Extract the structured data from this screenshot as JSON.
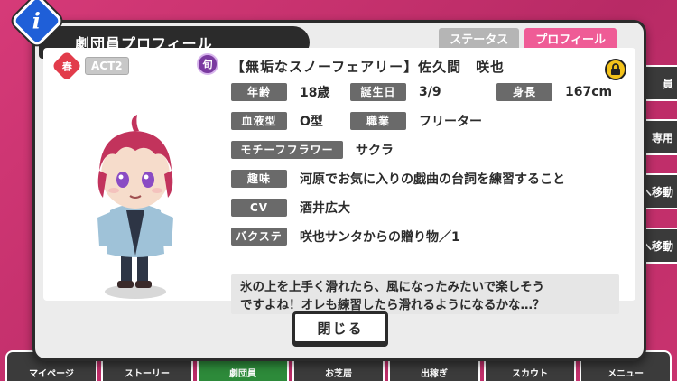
{
  "header": {
    "title": "劇団員プロフィール",
    "info_icon": "i"
  },
  "tabs": [
    {
      "label": "ステータス"
    },
    {
      "label": "プロフィール"
    }
  ],
  "card": {
    "season": "春",
    "act": "ACT2",
    "shun": "旬",
    "name": "【無垢なスノーフェアリー】佐久間　咲也"
  },
  "profile": {
    "age_label": "年齢",
    "age": "18歳",
    "birthday_label": "誕生日",
    "birthday": "3/9",
    "height_label": "身長",
    "height": "167cm",
    "blood_label": "血液型",
    "blood": "O型",
    "job_label": "職業",
    "job": "フリーター",
    "flower_label": "モチーフフラワー",
    "flower": "サクラ",
    "hobby_label": "趣味",
    "hobby": "河原でお気に入りの戯曲の台詞を練習すること",
    "cv_label": "CV",
    "cv": "酒井広大",
    "backstage_label": "バクステ",
    "backstage": "咲也サンタからの贈り物／1",
    "quote_line1": "氷の上を上手く滑れたら、風になったみたいで楽しそう",
    "quote_line2": "ですよね！オレも練習したら滑れるようになるかな…？"
  },
  "close_label": "閉じる",
  "background": {
    "right_buttons": [
      "員",
      "専用",
      "へ移動",
      "へ移動"
    ],
    "nav": [
      "マイページ",
      "ストーリー",
      "劇団員",
      "お芝居",
      "出稼ぎ",
      "スカウト",
      "メニュー"
    ]
  },
  "colors": {
    "accent_pink": "#ef5c96",
    "info_blue": "#1f5fd8",
    "season_red": "#e23c4b",
    "lock_yellow": "#f3c21a"
  }
}
